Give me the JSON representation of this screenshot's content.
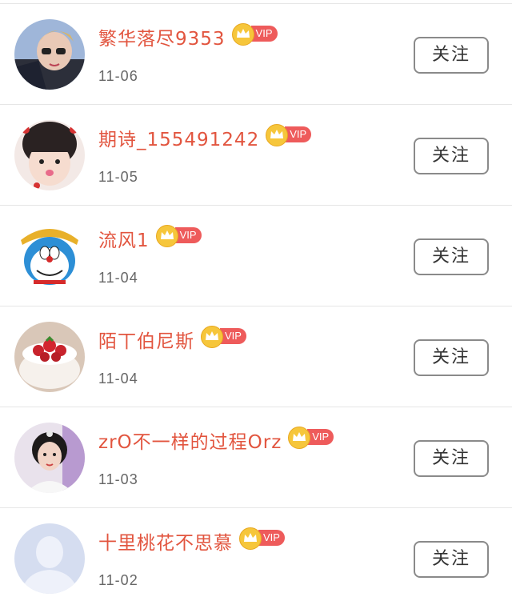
{
  "users": [
    {
      "name": "繁华落尽9353",
      "vip": "VIP",
      "date": "11-06",
      "follow_label": "关注",
      "avatar_icon": "user-avatar-selfie"
    },
    {
      "name": "期诗_155491242",
      "vip": "VIP",
      "date": "11-05",
      "follow_label": "关注",
      "avatar_icon": "user-avatar-child"
    },
    {
      "name": "流风1",
      "vip": "VIP",
      "date": "11-04",
      "follow_label": "关注",
      "avatar_icon": "user-avatar-doraemon"
    },
    {
      "name": "陌丅伯尼斯",
      "vip": "VIP",
      "date": "11-04",
      "follow_label": "关注",
      "avatar_icon": "user-avatar-cake"
    },
    {
      "name": "zrO不一样的过程Orz",
      "vip": "VIP",
      "date": "11-03",
      "follow_label": "关注",
      "avatar_icon": "user-avatar-woman"
    },
    {
      "name": "十里桃花不思慕",
      "vip": "VIP",
      "date": "11-02",
      "follow_label": "关注",
      "avatar_icon": "default-avatar-icon"
    }
  ],
  "colors": {
    "name": "#e2553f",
    "vip_tag": "#ee5b5b",
    "crown": "#f6c63b",
    "date": "#666666",
    "button_border": "#8a8a8a"
  }
}
